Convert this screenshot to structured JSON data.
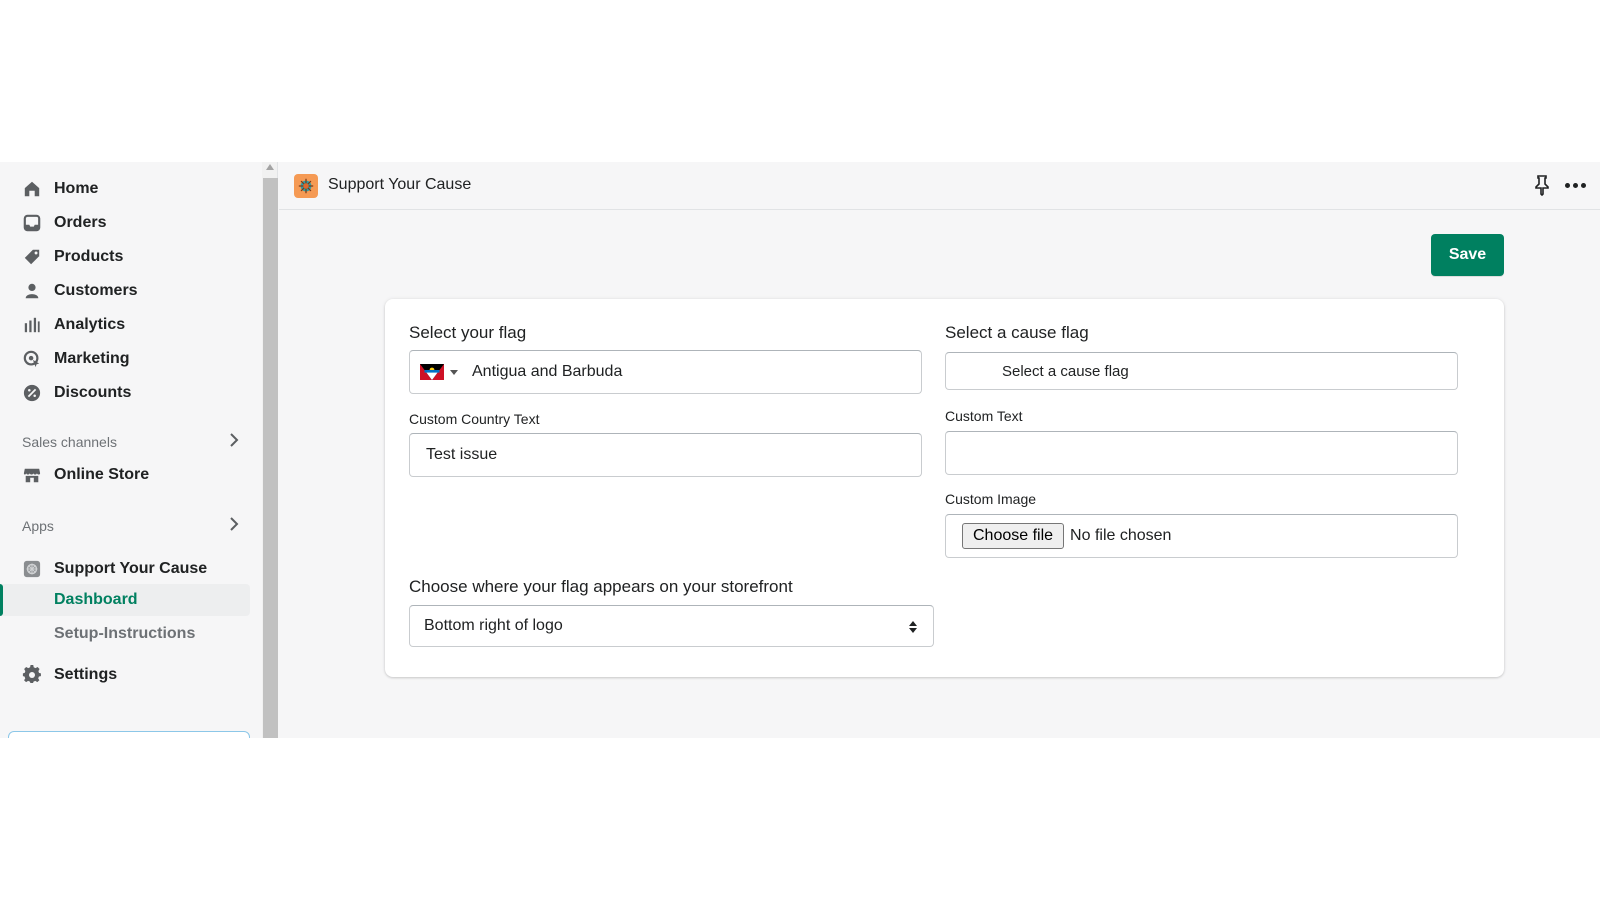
{
  "sidebar": {
    "items": [
      {
        "label": "Home",
        "icon": "home-icon"
      },
      {
        "label": "Orders",
        "icon": "orders-icon"
      },
      {
        "label": "Products",
        "icon": "tag-icon"
      },
      {
        "label": "Customers",
        "icon": "person-icon"
      },
      {
        "label": "Analytics",
        "icon": "bar-chart-icon"
      },
      {
        "label": "Marketing",
        "icon": "target-icon"
      },
      {
        "label": "Discounts",
        "icon": "discount-icon"
      }
    ],
    "sales_channels_label": "Sales channels",
    "online_store_label": "Online Store",
    "apps_label": "Apps",
    "app_name": "Support Your Cause",
    "app_subitems": [
      "Dashboard",
      "Setup-Instructions"
    ],
    "settings_label": "Settings"
  },
  "topbar": {
    "title": "Support Your Cause"
  },
  "toolbar": {
    "save_label": "Save"
  },
  "form": {
    "flag_label": "Select your flag",
    "flag_value": "Antigua and Barbuda",
    "cause_label": "Select a cause flag",
    "cause_placeholder": "Select a cause flag",
    "country_text_label": "Custom Country Text",
    "country_text_value": "Test issue",
    "custom_text_label": "Custom Text",
    "custom_text_value": "",
    "custom_image_label": "Custom Image",
    "choose_file_label": "Choose file",
    "no_file_label": "No file chosen",
    "position_label": "Choose where your flag appears on your storefront",
    "position_value": "Bottom right of logo"
  },
  "colors": {
    "accent": "#008060",
    "app_logo": "#f59a54"
  }
}
